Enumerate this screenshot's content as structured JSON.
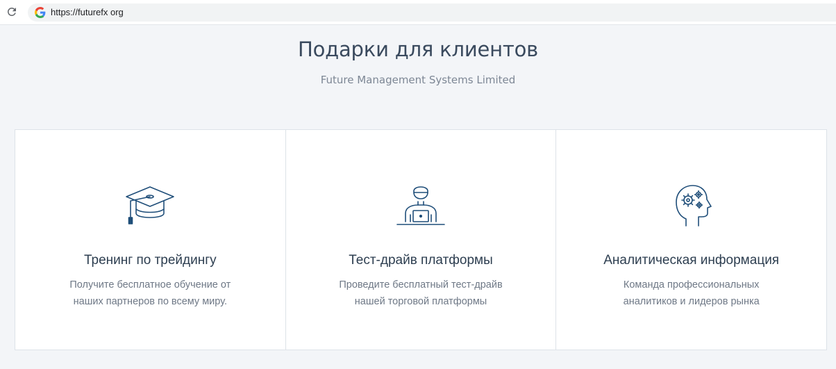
{
  "browser": {
    "url": "https://futurefx org",
    "icons": {
      "reload": "reload-icon",
      "site": "google-icon"
    }
  },
  "header": {
    "title": "Подарки для клиентов",
    "subtitle": "Future Management Systems Limited"
  },
  "cards": [
    {
      "icon": "graduation-cap-icon",
      "title": "Тренинг по трейдингу",
      "desc_line1": "Получите бесплатное обучение от",
      "desc_line2": "наших партнеров по всему миру."
    },
    {
      "icon": "person-laptop-icon",
      "title": "Тест-драйв платформы",
      "desc_line1": "Проведите бесплатный тест-драйв",
      "desc_line2": "нашей торговой платформы"
    },
    {
      "icon": "head-gears-icon",
      "title": "Аналитическая информация",
      "desc_line1": "Команда профессиональных",
      "desc_line2": "аналитиков и лидеров рынка"
    }
  ],
  "colors": {
    "background": "#f3f5f8",
    "icon_stroke": "#1f4e79",
    "title": "#2d3e50",
    "text_muted": "#6e7886"
  }
}
